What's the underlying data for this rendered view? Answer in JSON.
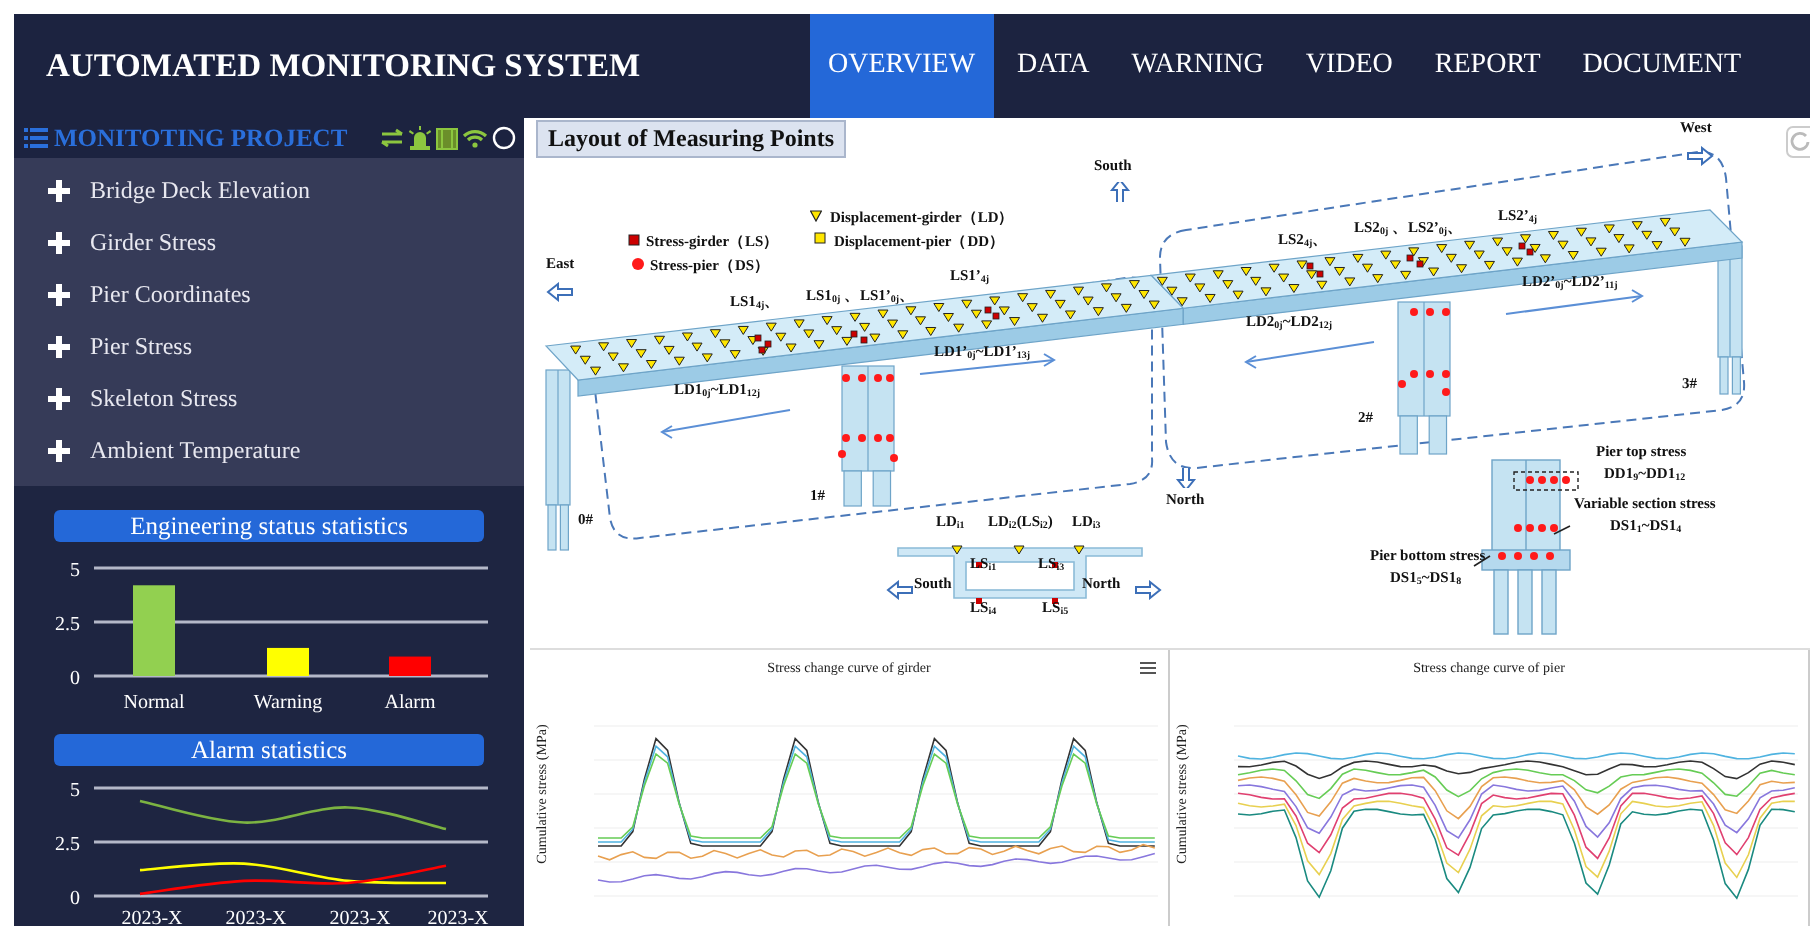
{
  "header": {
    "title": "AUTOMATED MONITORING SYSTEM",
    "nav": [
      {
        "label": "OVERVIEW",
        "selected": true
      },
      {
        "label": "DATA",
        "selected": false
      },
      {
        "label": "WARNING",
        "selected": false
      },
      {
        "label": "VIDEO",
        "selected": false
      },
      {
        "label": "REPORT",
        "selected": false
      },
      {
        "label": "DOCUMENT",
        "selected": false
      }
    ]
  },
  "sidebar": {
    "title": "MONITOTING PROJECT",
    "items": [
      "Bridge Deck Elevation",
      "Girder Stress",
      "Pier Coordinates",
      "Pier Stress",
      "Skeleton Stress",
      "Ambient Temperature"
    ]
  },
  "status_panel": {
    "title": "Engineering status statistics",
    "chart_data": {
      "type": "bar",
      "stacked": true,
      "categories": [
        "Normal",
        "Warning",
        "Alarm"
      ],
      "yticks": [
        0,
        2.5,
        5
      ],
      "ylim": [
        0,
        5
      ],
      "series": [
        {
          "color": "#92d050",
          "values": [
            4.2,
            null,
            null
          ]
        },
        {
          "color": "#ffff00",
          "values": [
            null,
            1.3,
            null
          ]
        },
        {
          "color": "#ff0000",
          "values": [
            null,
            null,
            0.9
          ]
        }
      ]
    }
  },
  "alarm_panel": {
    "title": "Alarm statistics",
    "chart_data": {
      "type": "line",
      "categories": [
        "2023-X",
        "2023-X",
        "2023-X",
        "2023-X"
      ],
      "yticks": [
        0,
        2.5,
        5
      ],
      "ylim": [
        0,
        5
      ],
      "series": [
        {
          "color": "#7cb342",
          "values": [
            4.4,
            3.4,
            4.1,
            3.1
          ]
        },
        {
          "color": "#ffff00",
          "values": [
            1.2,
            1.5,
            0.7,
            0.6
          ]
        },
        {
          "color": "#ff0000",
          "values": [
            0.1,
            0.7,
            0.6,
            1.4
          ]
        }
      ]
    }
  },
  "diagram": {
    "title": "Layout of Measuring Points",
    "legend": [
      {
        "kind": "square",
        "label": "Stress-girder（LS）"
      },
      {
        "kind": "dot",
        "label": "Stress-pier（DS）"
      },
      {
        "kind": "triangle",
        "label": "Displacement-girder（LD）"
      },
      {
        "kind": "yellow-square",
        "label": "Displacement-pier（DD）"
      }
    ],
    "directions": [
      "East",
      "South",
      "West",
      "North",
      "South",
      "North"
    ],
    "labels": [
      "LS1$_{4j}$、",
      "LS1$_{0j}$ 、LS1’$_{0j}$、",
      "LS1’$_{4j}$",
      "LD1’$_{0j}$~LD1’$_{13j}$",
      "LD1$_{0j}$~LD1$_{12j}$",
      "LS2$_{4j}$、",
      "LS2$_{0j}$ 、LS2’$_{0j}$、",
      "LS2’$_{4j}$",
      "LD2$_{0j}$~LD2$_{12j}$",
      "LD2’$_{0j}$~LD2’$_{11j}$",
      "0#",
      "1#",
      "2#",
      "3#",
      "LD$_{i1}$",
      "LD$_{i2}$(LS$_{i2}$)",
      "LD$_{i3}$",
      "LS$_{i1}$",
      "LS$_{i3}$",
      "LS$_{i4}$",
      "LS$_{i5}$",
      "Pier top stress",
      "DD1$_{9}$~DD1$_{12}$",
      "Variable section stress",
      "DS1$_{1}$~DS1$_{4}$",
      "Pier bottom stress",
      "DS1$_{5}$~DS1$_{8}$"
    ]
  },
  "girder_chart": {
    "title": "Stress change curve of girder",
    "ylabel": "Cumulative stress (MPa)"
  },
  "pier_chart": {
    "title": "Stress change curve of pier",
    "ylabel": "Cumulative stress (MPa)"
  }
}
